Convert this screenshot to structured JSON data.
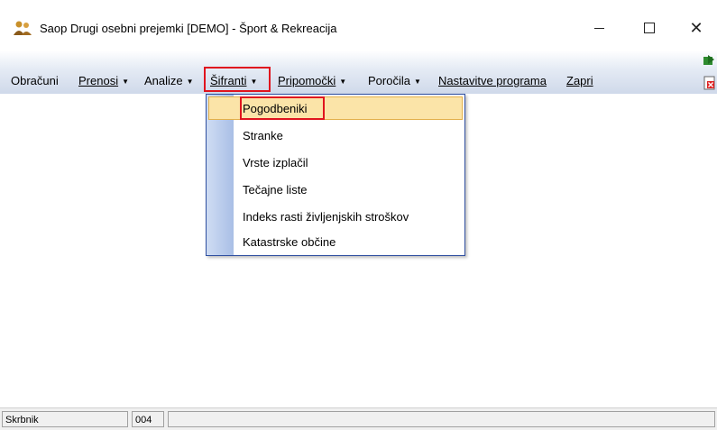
{
  "window": {
    "title": "Saop Drugi osebni prejemki [DEMO] - Šport & Rekreacija",
    "minimize_symbol": "—",
    "maximize_symbol": "☐",
    "close_symbol": "✕"
  },
  "menubar": {
    "items": [
      {
        "label": "Obračuni"
      },
      {
        "label": "Prenosi",
        "arrow": "▼"
      },
      {
        "label": "Analize",
        "arrow": "▼"
      },
      {
        "label": "Šifranti",
        "arrow": "▼"
      },
      {
        "label": "Pripomočki",
        "arrow": "▼"
      },
      {
        "label": "Poročila",
        "arrow": "▼"
      },
      {
        "label": "Nastavitve programa"
      },
      {
        "label": "Zapri"
      }
    ],
    "active_item": "Šifranti"
  },
  "dropdown": {
    "items": [
      {
        "label": "Pogodbeniki",
        "selected": true
      },
      {
        "label": "Stranke"
      },
      {
        "label": "Vrste izplačil"
      },
      {
        "label": "Tečajne liste"
      },
      {
        "label": "Indeks rasti življenjskih stroškov"
      },
      {
        "label": "Katastrske občine"
      }
    ]
  },
  "statusbar": {
    "user": "Skrbnik",
    "code": "004",
    "message": ""
  },
  "colors": {
    "highlight_red": "#e0141e",
    "menu_selected_bg": "#fbe4a8",
    "dropdown_border": "#2f4fa0"
  },
  "icons": {
    "app": "people-icon",
    "toolbar_top": "green-arrow-icon",
    "toolbar_doc": "document-close-icon"
  }
}
